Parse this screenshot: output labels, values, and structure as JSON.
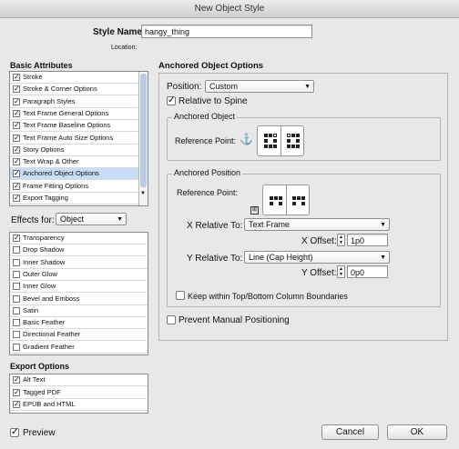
{
  "window": {
    "title": "New Object Style"
  },
  "style_name": {
    "label": "Style Name:",
    "value": "hangy_thing"
  },
  "location": {
    "label": "Location:"
  },
  "basic_attributes": {
    "heading": "Basic Attributes",
    "items": [
      {
        "label": "Stroke",
        "checked": true
      },
      {
        "label": "Stroke & Corner Options",
        "checked": true
      },
      {
        "label": "Paragraph Styles",
        "checked": true
      },
      {
        "label": "Text Frame General Options",
        "checked": true
      },
      {
        "label": "Text Frame Baseline Options",
        "checked": true
      },
      {
        "label": "Text Frame Auto Size Options",
        "checked": true
      },
      {
        "label": "Story Options",
        "checked": true
      },
      {
        "label": "Text Wrap & Other",
        "checked": true
      },
      {
        "label": "Anchored Object Options",
        "checked": true,
        "selected": true
      },
      {
        "label": "Frame Fitting Options",
        "checked": true
      },
      {
        "label": "Export Tagging",
        "checked": true
      }
    ]
  },
  "effects": {
    "label": "Effects for:",
    "selected": "Object",
    "items": [
      {
        "label": "Transparency",
        "checked": true
      },
      {
        "label": "Drop Shadow",
        "checked": false
      },
      {
        "label": "Inner Shadow",
        "checked": false
      },
      {
        "label": "Outer Glow",
        "checked": false
      },
      {
        "label": "Inner Glow",
        "checked": false
      },
      {
        "label": "Bevel and Emboss",
        "checked": false
      },
      {
        "label": "Satin",
        "checked": false
      },
      {
        "label": "Basic Feather",
        "checked": false
      },
      {
        "label": "Directional Feather",
        "checked": false
      },
      {
        "label": "Gradient Feather",
        "checked": false
      }
    ]
  },
  "export_options": {
    "heading": "Export Options",
    "items": [
      {
        "label": "Alt Text",
        "checked": true
      },
      {
        "label": "Tagged PDF",
        "checked": true
      },
      {
        "label": "EPUB and HTML",
        "checked": true
      }
    ]
  },
  "panel": {
    "heading": "Anchored Object Options",
    "position_label": "Position:",
    "position_value": "Custom",
    "relative_to_spine": "Relative to Spine",
    "anchored_object": {
      "title": "Anchored Object",
      "ref_point_label": "Reference Point:"
    },
    "anchored_position": {
      "title": "Anchored Position",
      "ref_point_label": "Reference Point:",
      "x_relative_label": "X Relative To:",
      "x_relative_value": "Text Frame",
      "x_offset_label": "X Offset:",
      "x_offset_value": "1p0",
      "y_relative_label": "Y Relative To:",
      "y_relative_value": "Line (Cap Height)",
      "y_offset_label": "Y Offset:",
      "y_offset_value": "0p0",
      "keep_within": "Keep within Top/Bottom Column Boundaries"
    },
    "prevent_manual": "Prevent Manual Positioning"
  },
  "footer": {
    "preview": "Preview",
    "cancel": "Cancel",
    "ok": "OK"
  },
  "colors": {
    "selection": "#c9ddf6",
    "background": "#e8e8e8"
  }
}
